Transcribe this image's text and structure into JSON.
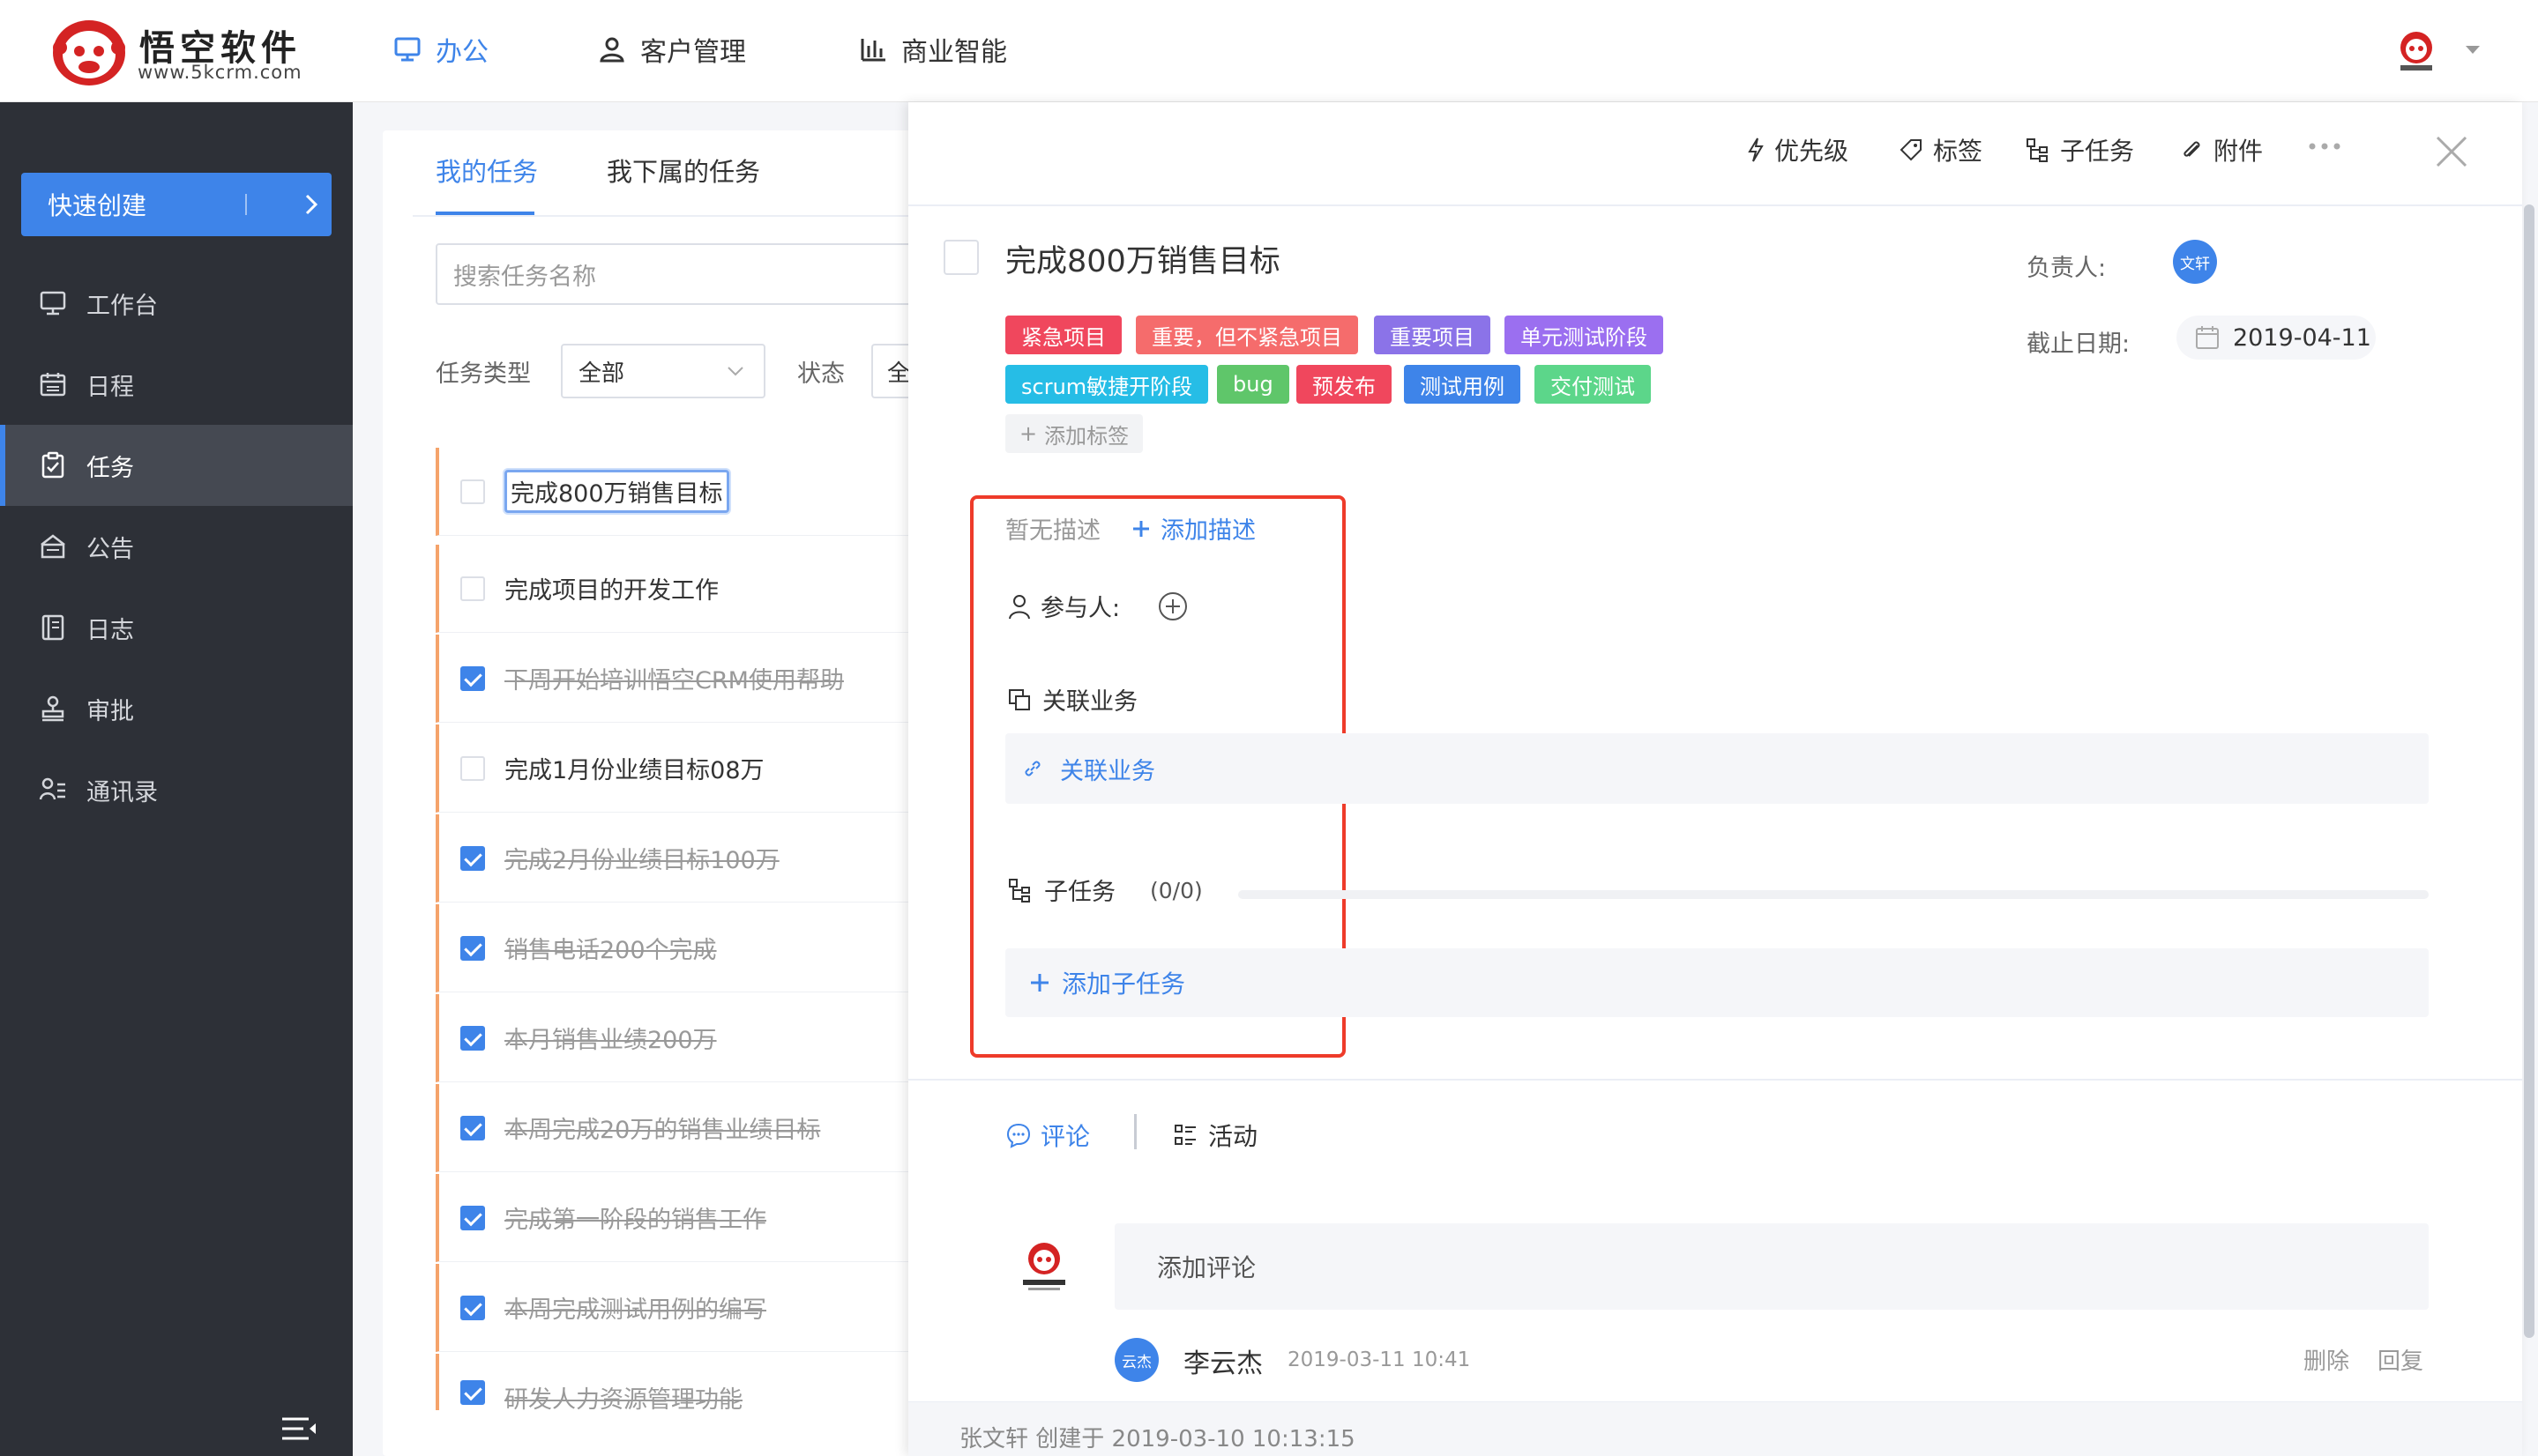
{
  "brand": {
    "name": "悟空软件",
    "url": "www.5kcrm.com"
  },
  "nav": {
    "items": [
      {
        "label": "办公",
        "icon": "monitor-icon"
      },
      {
        "label": "客户管理",
        "icon": "user-icon"
      },
      {
        "label": "商业智能",
        "icon": "bar-chart-icon"
      }
    ],
    "active": "办公"
  },
  "sidebar": {
    "quick_create": "快速创建",
    "items": [
      {
        "label": "工作台",
        "icon": "monitor-icon"
      },
      {
        "label": "日程",
        "icon": "calendar-icon"
      },
      {
        "label": "任务",
        "icon": "clipboard-icon"
      },
      {
        "label": "公告",
        "icon": "megaphone-icon"
      },
      {
        "label": "日志",
        "icon": "book-icon"
      },
      {
        "label": "审批",
        "icon": "stamp-icon"
      },
      {
        "label": "通讯录",
        "icon": "contacts-icon"
      }
    ],
    "active": "任务"
  },
  "task_list": {
    "tabs": [
      "我的任务",
      "我下属的任务"
    ],
    "search_placeholder": "搜索任务名称",
    "filter_type_label": "任务类型",
    "filter_type_value": "全部",
    "filter_status_label": "状态",
    "filter_status_value": "全",
    "tasks": [
      {
        "title": "完成800万销售目标",
        "done": false
      },
      {
        "title": "完成项目的开发工作",
        "done": false
      },
      {
        "title": "下周开始培训悟空CRM使用帮助",
        "done": true
      },
      {
        "title": "完成1月份业绩目标08万",
        "done": false
      },
      {
        "title": "完成2月份业绩目标100万",
        "done": true
      },
      {
        "title": "销售电话200个完成",
        "done": true
      },
      {
        "title": "本月销售业绩200万",
        "done": true
      },
      {
        "title": "本周完成20万的销售业绩目标",
        "done": true
      },
      {
        "title": "完成第一阶段的销售工作",
        "done": true
      },
      {
        "title": "本周完成测试用例的编写",
        "done": true
      },
      {
        "title": "研发人力资源管理功能",
        "done": true
      }
    ]
  },
  "detail": {
    "toolbar": {
      "priority": "优先级",
      "tag": "标签",
      "subtask": "子任务",
      "attachment": "附件"
    },
    "title": "完成800万销售目标",
    "owner_label": "负责人:",
    "owner_avatar": "文轩",
    "deadline_label": "截止日期:",
    "deadline": "2019-04-11",
    "tags": [
      {
        "label": "紧急项目",
        "color": "#f0475d"
      },
      {
        "label": "重要，但不紧急项目",
        "color": "#f56c6c"
      },
      {
        "label": "重要项目",
        "color": "#8b73e8"
      },
      {
        "label": "单元测试阶段",
        "color": "#9b6ff0"
      },
      {
        "label": "scrum敏捷开阶段",
        "color": "#26bde6"
      },
      {
        "label": "bug",
        "color": "#5fc66a"
      },
      {
        "label": "预发布",
        "color": "#f0475d"
      },
      {
        "label": "测试用例",
        "color": "#3e84e9"
      },
      {
        "label": "交付测试",
        "color": "#5cd68a"
      }
    ],
    "add_tag": "添加标签",
    "no_description": "暂无描述",
    "add_description": "添加描述",
    "participants_label": "参与人:",
    "related_title": "关联业务",
    "related_link": "关联业务",
    "subtask_title": "子任务",
    "subtask_count": "(0/0)",
    "subtask_progress": 0,
    "add_subtask": "添加子任务",
    "tabs": {
      "comment": "评论",
      "activity": "活动"
    },
    "comment_placeholder": "添加评论",
    "comment": {
      "avatar": "云杰",
      "author": "李云杰",
      "time": "2019-03-11 10:41",
      "delete": "删除",
      "reply": "回复"
    },
    "creator_info": "张文轩 创建于 2019-03-10 10:13:15"
  },
  "colors": {
    "primary": "#3e84e9",
    "sidebar_bg": "#2d3037",
    "highlight_box": "#ee3b2a",
    "task_row_marker": "#f5a36b"
  }
}
